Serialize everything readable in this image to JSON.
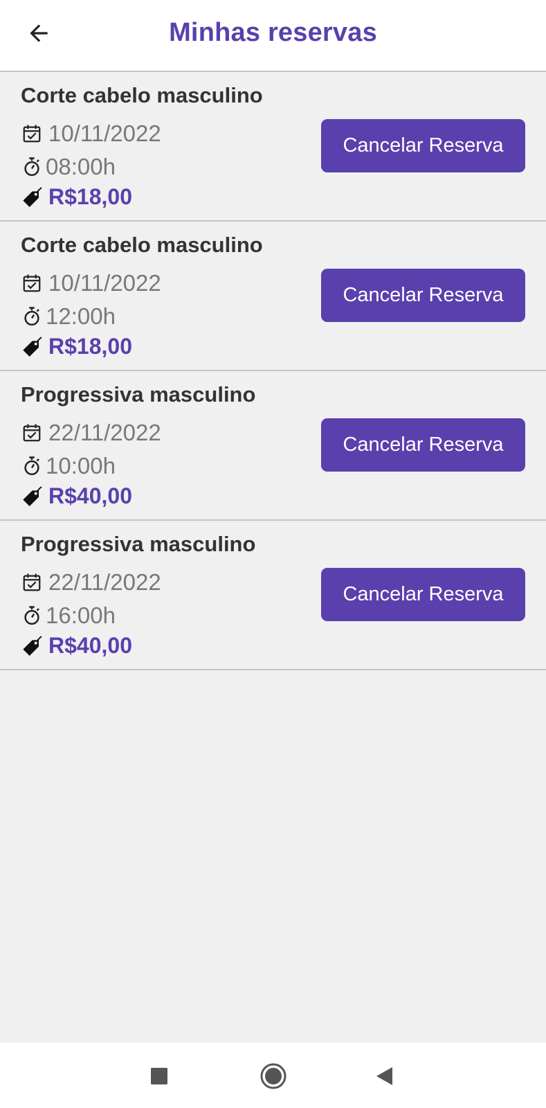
{
  "header": {
    "title": "Minhas reservas",
    "back_icon": "arrow-left-icon"
  },
  "colors": {
    "accent": "#5940ad",
    "background": "#f0f0f1",
    "divider": "#c4c4ca",
    "secondary_text": "#77777c",
    "title_text": "#333336"
  },
  "reservations": [
    {
      "service": "Corte cabelo masculino",
      "date": "10/11/2022",
      "time": "08:00h",
      "price": "R$18,00",
      "cancel_label": "Cancelar Reserva"
    },
    {
      "service": "Corte cabelo masculino",
      "date": "10/11/2022",
      "time": "12:00h",
      "price": "R$18,00",
      "cancel_label": "Cancelar Reserva"
    },
    {
      "service": "Progressiva masculino",
      "date": "22/11/2022",
      "time": "10:00h",
      "price": "R$40,00",
      "cancel_label": "Cancelar Reserva"
    },
    {
      "service": "Progressiva masculino",
      "date": "22/11/2022",
      "time": "16:00h",
      "price": "R$40,00",
      "cancel_label": "Cancelar Reserva"
    }
  ],
  "row_icons": {
    "date": "calendar-check-icon",
    "time": "stopwatch-icon",
    "price": "price-tag-icon"
  },
  "system_nav": {
    "buttons": [
      "recents-square-icon",
      "home-circle-icon",
      "back-triangle-icon"
    ]
  }
}
